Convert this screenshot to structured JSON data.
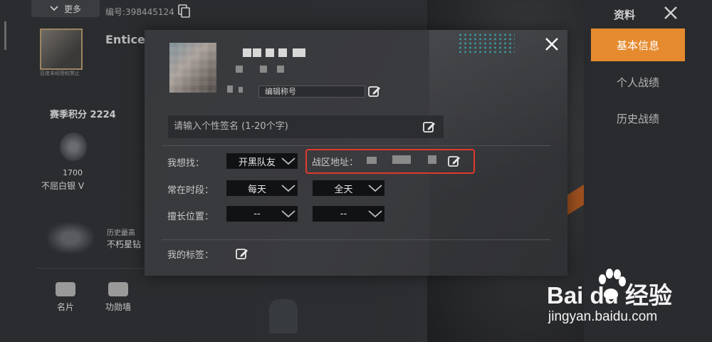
{
  "top_bar": {
    "more_label": "更多",
    "id_text": "编号:398445124"
  },
  "profile": {
    "name_partial": "Enticer",
    "avatar_caption": "百度未经授权禁止",
    "season_score": "赛季积分 2224",
    "rank_points": "1700",
    "rank_name": "不屈白银 V",
    "history_label": "历史最高",
    "history_value": "不朽星钻"
  },
  "bottom_tools": [
    {
      "label": "名片"
    },
    {
      "label": "功勋墙"
    }
  ],
  "right_panel": {
    "title": "资料",
    "menu": [
      {
        "label": "基本信息",
        "active": true
      },
      {
        "label": "个人战绩",
        "active": false
      },
      {
        "label": "历史战绩",
        "active": false
      }
    ]
  },
  "modal": {
    "nickname_placeholder": "编辑称号",
    "signature_placeholder": "请输入个性签名 (1-20个字)",
    "looking_for": {
      "label": "我想找：",
      "value": "开黑队友"
    },
    "region": {
      "label": "战区地址："
    },
    "active_time": {
      "label": "常在时段：",
      "value1": "每天",
      "value2": "全天"
    },
    "position": {
      "label": "擅长位置：",
      "value1": "--",
      "value2": "--"
    },
    "tags": {
      "label": "我的标签："
    }
  },
  "watermark": {
    "brand": "Bai du 经验",
    "url": "jingyan.baidu.com"
  },
  "colors": {
    "accent": "#e58a2e",
    "highlight": "#e0392b"
  }
}
